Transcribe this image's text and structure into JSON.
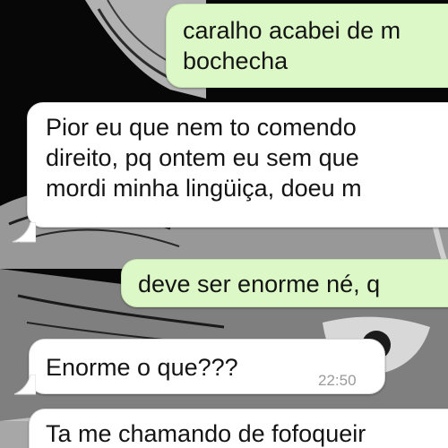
{
  "chat": {
    "messages": [
      {
        "id": "m1",
        "direction": "outgoing",
        "lines": [
          "caralho acabei de m",
          "bochecha"
        ]
      },
      {
        "id": "m2",
        "direction": "incoming",
        "lines": [
          "Pior eu que nem to comendo",
          "direito, pq ontem eu sem que",
          "mordi minha lingüiça, doeu m"
        ]
      },
      {
        "id": "m3",
        "direction": "outgoing",
        "lines": [
          "deve ser enorme né, q"
        ]
      },
      {
        "id": "m4",
        "direction": "incoming",
        "lines": [
          "Enorme o que???"
        ],
        "time": "22:50"
      },
      {
        "id": "m5",
        "direction": "incoming",
        "lines": [
          "Ta me chamando de fofoqueir"
        ]
      }
    ]
  },
  "colors": {
    "outgoing_bubble": "#dcf8c6",
    "incoming_bubble": "#ffffff",
    "wallpaper": "#0a0a0a"
  }
}
